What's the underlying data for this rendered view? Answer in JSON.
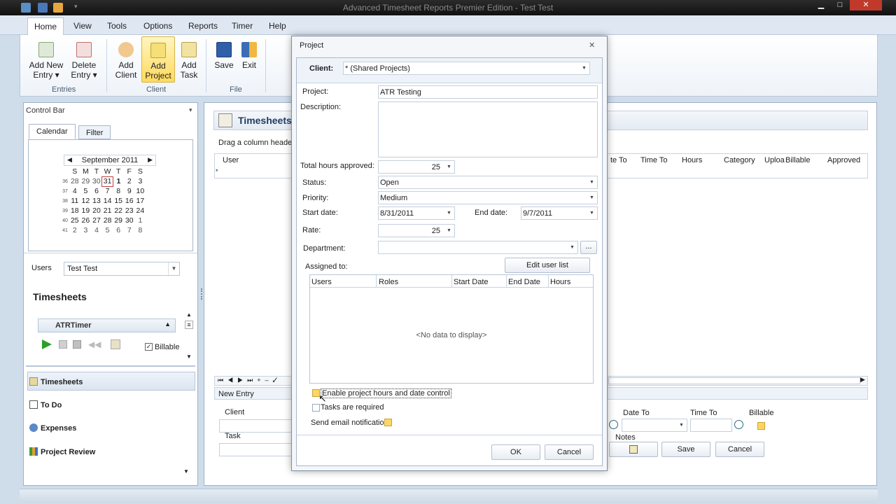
{
  "window": {
    "title": "Advanced Timesheet Reports Premier Edition - Test Test"
  },
  "ribbon": {
    "tabs": [
      "Home",
      "View",
      "Tools",
      "Options",
      "Reports",
      "Timer",
      "Help"
    ],
    "buttons": {
      "add_new_entry": [
        "Add New",
        "Entry ▾"
      ],
      "delete_entry": [
        "Delete",
        "Entry ▾"
      ],
      "add_client": [
        "Add",
        "Client"
      ],
      "add_project": [
        "Add",
        "Project"
      ],
      "add_task": [
        "Add",
        "Task"
      ],
      "save": "Save",
      "exit": "Exit"
    },
    "groups": {
      "entries": "Entries",
      "client": "Client",
      "file": "File"
    }
  },
  "left": {
    "header": "Control Bar",
    "tabs": {
      "calendar": "Calendar",
      "filter": "Filter"
    },
    "calendar": {
      "month": "September 2011",
      "weekdays": [
        "S",
        "M",
        "T",
        "W",
        "T",
        "F",
        "S"
      ],
      "weeks": [
        {
          "wk": "36",
          "days": [
            "28",
            "29",
            "30",
            "31",
            "1",
            "2",
            "3"
          ]
        },
        {
          "wk": "37",
          "days": [
            "4",
            "5",
            "6",
            "7",
            "8",
            "9",
            "10"
          ]
        },
        {
          "wk": "38",
          "days": [
            "11",
            "12",
            "13",
            "14",
            "15",
            "16",
            "17"
          ]
        },
        {
          "wk": "39",
          "days": [
            "18",
            "19",
            "20",
            "21",
            "22",
            "23",
            "24"
          ]
        },
        {
          "wk": "40",
          "days": [
            "25",
            "26",
            "27",
            "28",
            "29",
            "30",
            "1"
          ]
        },
        {
          "wk": "41",
          "days": [
            "2",
            "3",
            "4",
            "5",
            "6",
            "7",
            "8"
          ]
        }
      ]
    },
    "users_label": "Users",
    "users_value": "Test Test",
    "timesheets_title": "Timesheets",
    "timer_name": "ATRTimer",
    "billable": "Billable",
    "nav": {
      "timesheets": "Timesheets",
      "todo": "To Do",
      "expenses": "Expenses",
      "project_review": "Project Review"
    }
  },
  "main": {
    "title": "Timesheets",
    "drag_hint": "Drag a column header h",
    "grid_headers": {
      "user": "User",
      "date_to": "te To",
      "time_to": "Time To",
      "hours": "Hours",
      "category": "Category",
      "upload": "Uploa",
      "billable": "Billable",
      "approved": "Approved"
    },
    "new_entry": "New Entry",
    "client_label": "Client",
    "task_label": "Task",
    "date_to_label": "Date To",
    "time_to_label": "Time To",
    "billable_label": "Billable",
    "notes_label": "Notes",
    "save": "Save",
    "cancel": "Cancel"
  },
  "dialog": {
    "title": "Project",
    "client_label": "Client:",
    "client_value": "* (Shared Projects)",
    "project_label": "Project:",
    "project_value": "ATR Testing",
    "description_label": "Description:",
    "total_hours_label": "Total hours approved:",
    "total_hours_value": "25",
    "status_label": "Status:",
    "status_value": "Open",
    "priority_label": "Priority:",
    "priority_value": "Medium",
    "start_date_label": "Start date:",
    "start_date_value": "8/31/2011",
    "end_date_label": "End date:",
    "end_date_value": "9/7/2011",
    "rate_label": "Rate:",
    "rate_value": "25",
    "department_label": "Department:",
    "department_more": "...",
    "assigned_label": "Assigned to:",
    "edit_user_list": "Edit user list",
    "assigned_columns": [
      "Users",
      "Roles",
      "Start Date",
      "End Date",
      "Hours"
    ],
    "no_data": "<No data to display>",
    "enable_hours_control": "Enable project hours and date control",
    "tasks_required": "Tasks are required",
    "send_email": "Send email notification",
    "ok": "OK",
    "cancel": "Cancel"
  }
}
